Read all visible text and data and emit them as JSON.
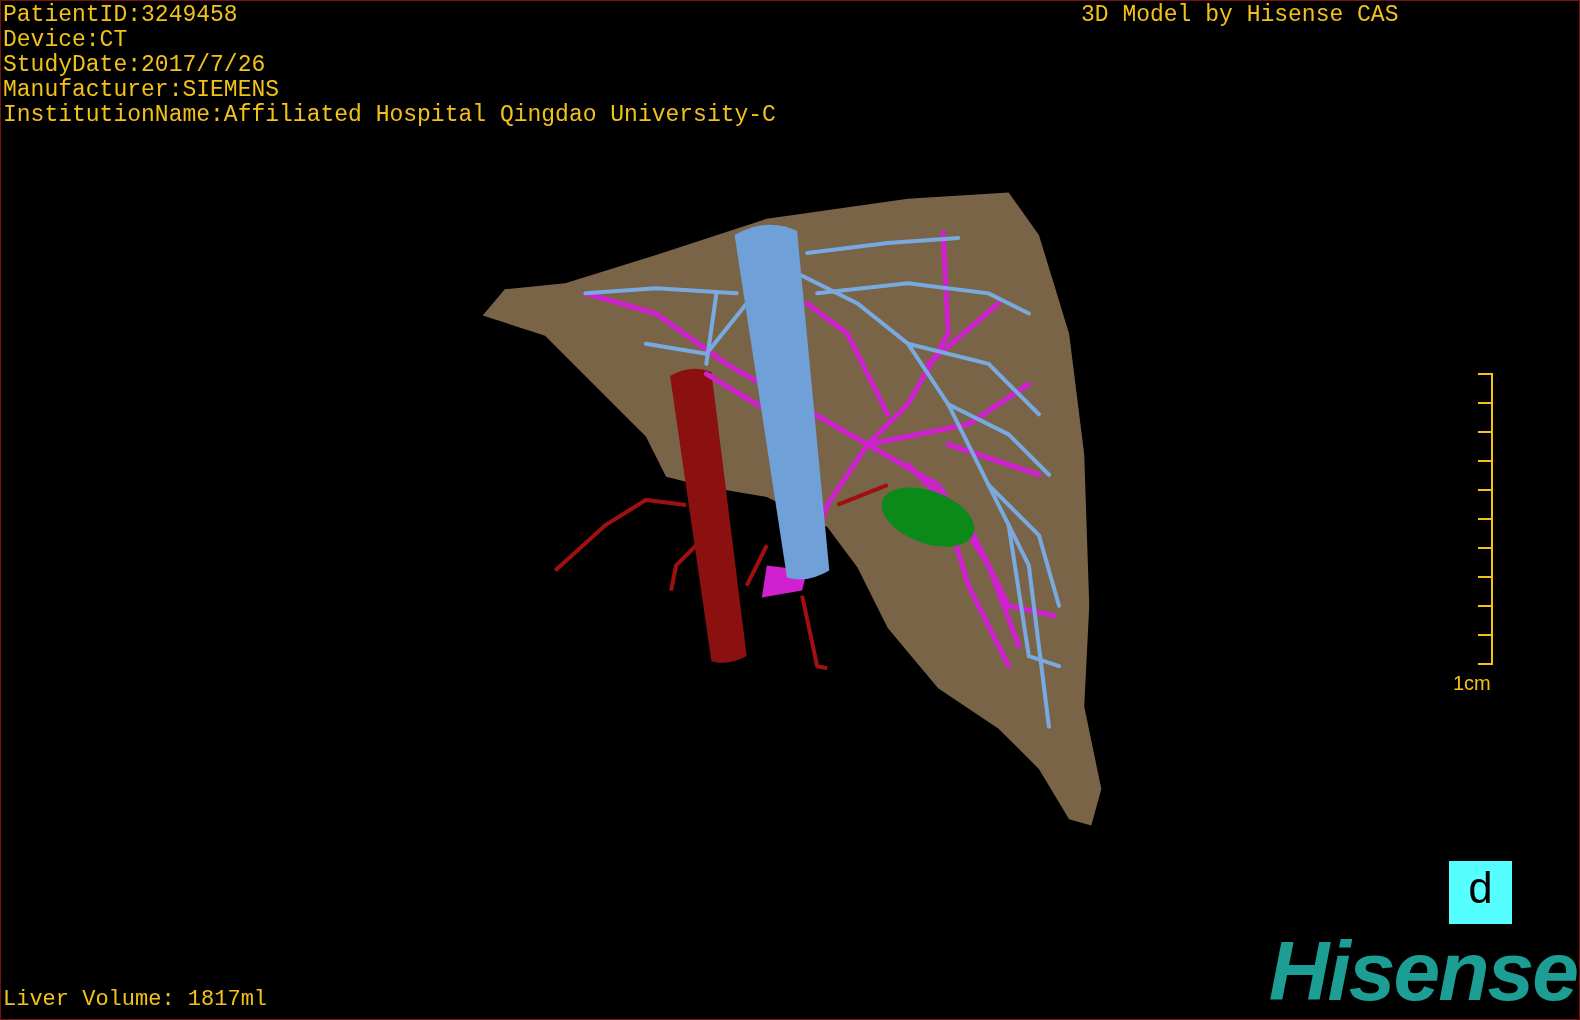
{
  "header": {
    "info_lines": [
      "PatientID:3249458",
      "Device:CT",
      "StudyDate:2017/7/26",
      "Manufacturer:SIEMENS",
      "InstitutionName:Affiliated Hospital Qingdao University-C"
    ],
    "title": "3D Model by Hisense CAS"
  },
  "scale_bar": {
    "label": "1cm"
  },
  "panel_label": "d",
  "footer": {
    "volume": "Liver Volume: 1817ml",
    "logo": "Hisense"
  }
}
